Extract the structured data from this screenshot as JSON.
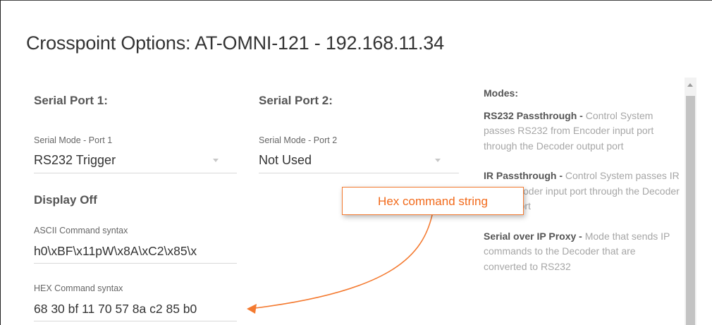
{
  "dialog": {
    "title": "Crosspoint Options: AT-OMNI-121 - 192.168.11.34"
  },
  "serial_port_1": {
    "heading": "Serial Port 1:",
    "mode_caption": "Serial Mode - Port 1",
    "mode_value": "RS232 Trigger"
  },
  "serial_port_2": {
    "heading": "Serial Port 2:",
    "mode_caption": "Serial Mode - Port 2",
    "mode_value": "Not Used"
  },
  "command": {
    "heading": "Display Off",
    "ascii_caption": "ASCII Command syntax",
    "ascii_value": "h0\\xBF\\x11pW\\x8A\\xC2\\x85\\x",
    "hex_caption": "HEX Command syntax",
    "hex_value": "68 30 bf 11 70 57 8a c2 85 b0"
  },
  "modes": {
    "title": "Modes:",
    "items": [
      {
        "name": "RS232 Passthrough -",
        "desc": " Control System passes RS232 from Encoder input port through the Decoder output port"
      },
      {
        "name": "IR Passthrough -",
        "desc": " Control System passes IR from Encoder input port through the Decoder output port"
      },
      {
        "name": "Serial over IP Proxy -",
        "desc": " Mode that sends IP commands to the Decoder that are converted to RS232"
      }
    ]
  },
  "annotation": {
    "callout_text": "Hex command string",
    "color": "#f47a30"
  }
}
